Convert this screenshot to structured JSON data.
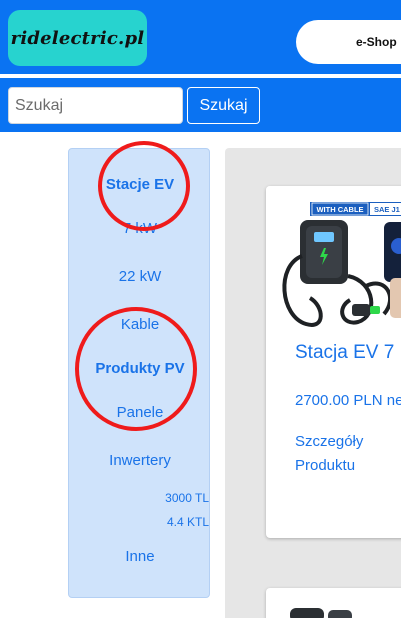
{
  "header": {
    "logo_text": "ridelectric.pl",
    "eshop_label": "e-Shop"
  },
  "search": {
    "placeholder": "Szukaj",
    "value": "",
    "button_label": "Szukaj"
  },
  "sidebar": {
    "items": [
      {
        "label": "Stacje EV",
        "style": "bold"
      },
      {
        "label": "7 kW",
        "style": "reg"
      },
      {
        "label": "22 kW",
        "style": "reg"
      },
      {
        "label": "Kable",
        "style": "reg"
      },
      {
        "label": "Produkty PV",
        "style": "bold"
      },
      {
        "label": "Panele",
        "style": "reg"
      },
      {
        "label": "Inwertery",
        "style": "reg"
      },
      {
        "label": "3000 TL",
        "style": "small"
      },
      {
        "label": "4.4 KTL",
        "style": "small"
      },
      {
        "label": "Inne",
        "style": "reg"
      }
    ]
  },
  "products": [
    {
      "badges": [
        "WITH CABLE",
        "SAE J1"
      ],
      "title": "Stacja EV 7",
      "price": "2700.00 PLN ne",
      "details_line1": "Szczegóły",
      "details_line2": "Produktu"
    }
  ],
  "colors": {
    "primary": "#0a73f2",
    "logo_bg": "#27d3cf",
    "sidebar_bg": "#cfe3fb",
    "link": "#1a73e8",
    "annotation": "#ef1b1b"
  }
}
